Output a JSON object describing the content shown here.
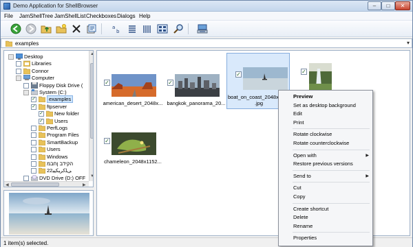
{
  "window": {
    "title": "Demo Application for ShellBrowser"
  },
  "menu": [
    "File",
    "JamShellTree",
    "JamShellList",
    "Checkboxes",
    "Dialogs",
    "Help"
  ],
  "toolbar": {
    "icons": [
      "back-icon",
      "forward-icon",
      "up-folder-icon",
      "new-folder-icon",
      "delete-icon",
      "properties-icon",
      "sort-icon",
      "list-view-icon",
      "details-view-icon",
      "thumbnails-view-icon",
      "search-icon",
      "network-icon"
    ]
  },
  "address": {
    "value": "examples"
  },
  "tree": {
    "items": [
      {
        "label": "Desktop",
        "indent": 0,
        "checked": "partial",
        "icon": "desktop-icon"
      },
      {
        "label": "Libraries",
        "indent": 1,
        "checked": "none",
        "icon": "libraries-icon"
      },
      {
        "label": "Connor",
        "indent": 1,
        "checked": "none",
        "icon": "user-folder-icon"
      },
      {
        "label": "Computer",
        "indent": 1,
        "checked": "partial",
        "icon": "computer-icon"
      },
      {
        "label": "Floppy Disk Drive (",
        "indent": 2,
        "checked": "none",
        "icon": "floppy-icon"
      },
      {
        "label": "System (C:)",
        "indent": 2,
        "checked": "partial",
        "icon": "drive-icon"
      },
      {
        "label": "examples",
        "indent": 3,
        "checked": "checked",
        "icon": "folder-icon",
        "selected": true
      },
      {
        "label": "ftpserver",
        "indent": 3,
        "checked": "checked",
        "icon": "folder-icon"
      },
      {
        "label": "New folder",
        "indent": 4,
        "checked": "checked",
        "icon": "folder-icon"
      },
      {
        "label": "Users",
        "indent": 4,
        "checked": "checked",
        "icon": "folder-icon"
      },
      {
        "label": "PerfLogs",
        "indent": 3,
        "checked": "none",
        "icon": "folder-icon"
      },
      {
        "label": "Program Files",
        "indent": 3,
        "checked": "none",
        "icon": "folder-icon"
      },
      {
        "label": "SmartBackup",
        "indent": 3,
        "checked": "none",
        "icon": "folder-icon"
      },
      {
        "label": "Users",
        "indent": 3,
        "checked": "none",
        "icon": "folder-icon"
      },
      {
        "label": "Windows",
        "indent": 3,
        "checked": "none",
        "icon": "folder-icon"
      },
      {
        "label": "הקידב ןחבמ",
        "indent": 3,
        "checked": "none",
        "icon": "folder-icon"
      },
      {
        "label": "22ﻰﻠﻛﺮﺒﻜﯿﺒ",
        "indent": 3,
        "checked": "none",
        "icon": "folder-icon"
      },
      {
        "label": "DVD Drive (D:) OFF",
        "indent": 2,
        "checked": "none",
        "icon": "dvd-icon"
      }
    ]
  },
  "files": [
    {
      "label": "american_desert_2048x...",
      "checked": true,
      "image": "desert"
    },
    {
      "label": "bangkok_panorama_20...",
      "checked": true,
      "image": "city"
    },
    {
      "label": "boat_on_coast_2048x1152.jpg",
      "checked": true,
      "image": "boat",
      "selected": true
    },
    {
      "label": "",
      "checked": true,
      "image": "waterfall"
    },
    {
      "label": "chameleon_2048x1152...",
      "checked": true,
      "image": "chameleon"
    }
  ],
  "context_menu": {
    "items": [
      {
        "label": "Preview",
        "bold": true
      },
      {
        "label": "Set as desktop background"
      },
      {
        "label": "Edit"
      },
      {
        "label": "Print"
      },
      {
        "sep": true
      },
      {
        "label": "Rotate clockwise"
      },
      {
        "label": "Rotate counterclockwise"
      },
      {
        "sep": true
      },
      {
        "label": "Open with",
        "submenu": true
      },
      {
        "label": "Restore previous versions"
      },
      {
        "sep": true
      },
      {
        "label": "Send to",
        "submenu": true
      },
      {
        "sep": true
      },
      {
        "label": "Cut"
      },
      {
        "label": "Copy"
      },
      {
        "sep": true
      },
      {
        "label": "Create shortcut"
      },
      {
        "label": "Delete"
      },
      {
        "label": "Rename"
      },
      {
        "sep": true
      },
      {
        "label": "Properties"
      }
    ]
  },
  "status": {
    "text": "1 item(s) selected."
  },
  "colors": {
    "selection": "#d9e9fb",
    "selection_border": "#84acdd",
    "folder": "#e8c25a"
  }
}
